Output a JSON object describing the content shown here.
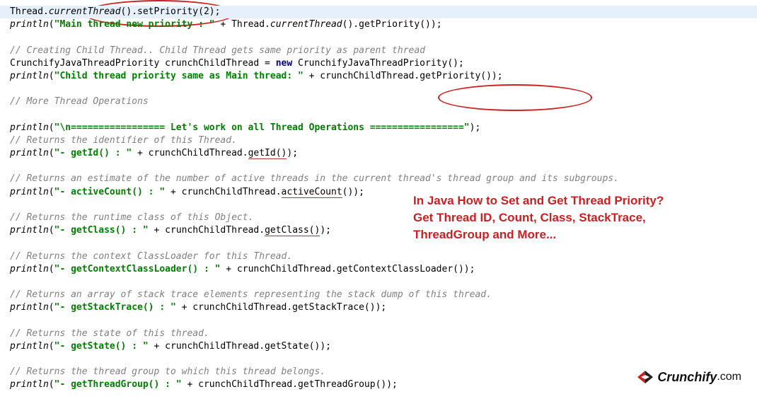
{
  "line1": {
    "pre1": "Thread.",
    "cur": "currentThread",
    "post1": "().",
    "setp": "setPriority",
    "post2": "(2);"
  },
  "line2": {
    "fn": "println",
    "open": "(",
    "str": "\"Main thread new priority : \"",
    "post": " + Thread.",
    "cur": "currentThread",
    "tail": "().getPriority());"
  },
  "line4_cmt": "// Creating Child Thread.. Child Thread gets same priority as parent thread",
  "line5": {
    "pre": "CrunchifyJavaThreadPriority crunchChildThread = ",
    "new": "new",
    "post": " CrunchifyJavaThreadPriority();"
  },
  "line6": {
    "fn": "println",
    "open": "(",
    "str": "\"Child thread priority same as Main thread: \"",
    "post": " + crunchChildThread.getPriority());"
  },
  "line8_cmt": "// More Thread Operations",
  "line10": {
    "fn": "println",
    "open": "(",
    "str": "\"\\n================= Let's work on all Thread Operations =================\"",
    "post": ");"
  },
  "line11_cmt": "// Returns the identifier of this Thread.",
  "line12": {
    "fn": "println",
    "open": "(",
    "str": "\"- getId() : \"",
    "mid": " + crunchChildThread.",
    "u": "getId()",
    "post": ");"
  },
  "line14_cmt": "// Returns an estimate of the number of active threads in the current thread's thread group and its subgroups.",
  "line15": {
    "fn": "println",
    "open": "(",
    "str": "\"- activeCount() : \"",
    "mid": " + crunchChildThread.",
    "u": "activeCount",
    "post": "());"
  },
  "line17_cmt": "// Returns the runtime class of this Object.",
  "line18": {
    "fn": "println",
    "open": "(",
    "str": "\"- getClass() : \"",
    "mid": " + crunchChildThread.",
    "u": "getClass()",
    "post": ");"
  },
  "line20_cmt": "// Returns the context ClassLoader for this Thread.",
  "line21": {
    "fn": "println",
    "open": "(",
    "str": "\"- getContextClassLoader() : \"",
    "post": " + crunchChildThread.getContextClassLoader());"
  },
  "line23_cmt": "// Returns an array of stack trace elements representing the stack dump of this thread.",
  "line24": {
    "fn": "println",
    "open": "(",
    "str": "\"- getStackTrace() : \"",
    "post": " + crunchChildThread.getStackTrace());"
  },
  "line26_cmt": "// Returns the state of this thread.",
  "line27": {
    "fn": "println",
    "open": "(",
    "str": "\"- getState() : \"",
    "post": " + crunchChildThread.getState());"
  },
  "line29_cmt": "// Returns the thread group to which this thread belongs.",
  "line30": {
    "fn": "println",
    "open": "(",
    "str": "\"- getThreadGroup() : \"",
    "post": " + crunchChildThread.getThreadGroup());"
  },
  "callout": {
    "l1": "In Java How to Set and Get Thread Priority?",
    "l2": "Get Thread ID, Count, Class, StackTrace,",
    "l3": "ThreadGroup and More..."
  },
  "logo": {
    "crunch": "Crunch",
    "ify": "ify",
    "dotcom": ".com"
  }
}
